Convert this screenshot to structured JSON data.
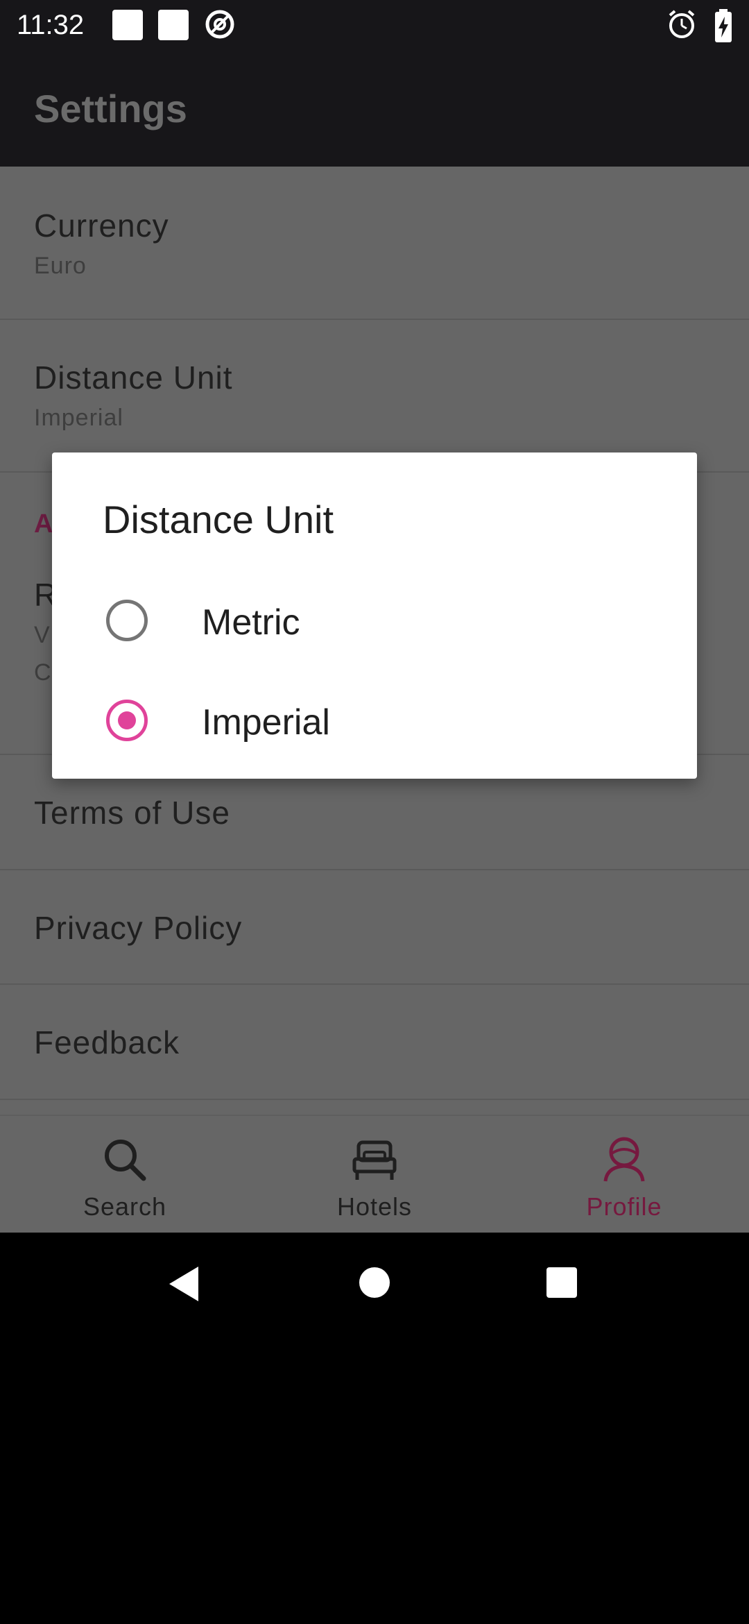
{
  "status_bar": {
    "time": "11:32"
  },
  "app_bar": {
    "title": "Settings"
  },
  "settings": {
    "currency": {
      "title": "Currency",
      "value": "Euro"
    },
    "distance_unit": {
      "title": "Distance Unit",
      "value": "Imperial"
    },
    "section_header_partial": "A",
    "partial_item": {
      "title_partial": "R",
      "line1_partial": "V",
      "line2_partial": "C"
    },
    "terms": {
      "title": "Terms of Use"
    },
    "privacy": {
      "title": "Privacy Policy"
    },
    "feedback": {
      "title": "Feedback"
    }
  },
  "bottom_nav": {
    "items": [
      {
        "label": "Search",
        "icon": "search-icon",
        "active": false
      },
      {
        "label": "Hotels",
        "icon": "bed-icon",
        "active": false
      },
      {
        "label": "Profile",
        "icon": "profile-icon",
        "active": true
      }
    ]
  },
  "dialog": {
    "title": "Distance Unit",
    "options": [
      {
        "label": "Metric",
        "selected": false
      },
      {
        "label": "Imperial",
        "selected": true
      }
    ]
  },
  "colors": {
    "accent": "#e0439a",
    "active_nav": "#76193f",
    "scrim_content": "#666666",
    "app_bar": "#171619"
  }
}
